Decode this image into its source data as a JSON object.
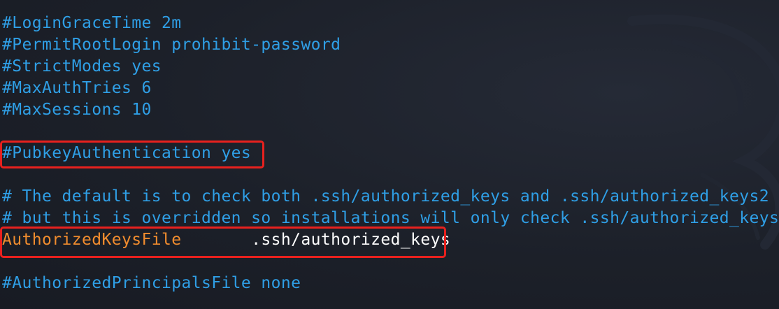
{
  "terminal": {
    "lines": [
      "#LoginGraceTime 2m",
      "#PermitRootLogin prohibit-password",
      "#StrictModes yes",
      "#MaxAuthTries 6",
      "#MaxSessions 10",
      "",
      "#PubkeyAuthentication yes",
      "",
      "# The default is to check both .ssh/authorized_keys and .ssh/authorized_keys2",
      "# but this is overridden so installations will only check .ssh/authorized_keys",
      "",
      "",
      "#AuthorizedPrincipalsFile none"
    ],
    "directive": {
      "key": "AuthorizedKeysFile",
      "value": ".ssh/authorized_keys"
    }
  },
  "colors": {
    "comment": "#2f9fe6",
    "keyword": "#f08c2e",
    "value": "#ffffff",
    "highlight": "#e8211e",
    "background": "#1c2029"
  }
}
